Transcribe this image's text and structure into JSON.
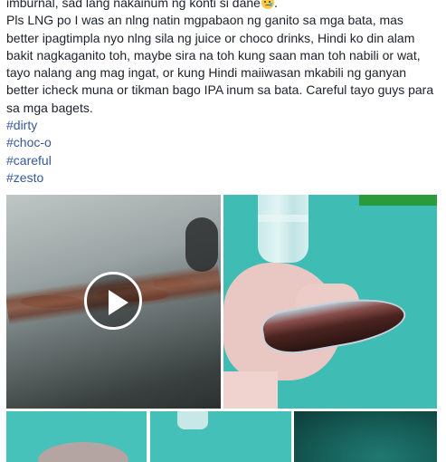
{
  "post": {
    "lines": [
      "imburnal, sad lang nakainum ng konti si dane",
      "Pls LNG po I was an nlng natin mgpabaon ng ganito sa mga bata, mas",
      "better ipagtimpla nyo nlng sila ng juice or choco drinks, Hindi ko din alam",
      "bakit nagkaganito toh, maybe sira na toh kung saan man toh nabili or wat,",
      "tayo nalang ang mag ingat, or kung Hindi maiiwasan mkabili ng ganyan",
      "better icheck muna or tikman bago IPA inum sa bata. Careful tayo guys para",
      "sa mga bagets."
    ],
    "line1_suffix": ".",
    "emoji": "sad-tear-emoji",
    "hashtags": [
      "#dirty",
      "#choc-o",
      "#careful",
      "#zesto"
    ],
    "colors": {
      "text": "#1d2129",
      "link": "#365899"
    }
  },
  "media": {
    "video_play_icon": "play-icon",
    "photos": [
      "video-thumbnail",
      "photo-hand-packet",
      "photo-thumb-1",
      "photo-thumb-2",
      "photo-thumb-3"
    ]
  }
}
